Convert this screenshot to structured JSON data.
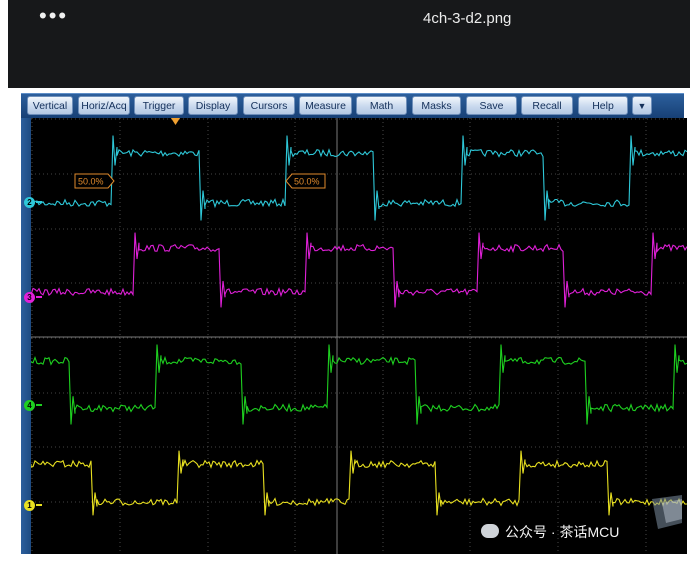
{
  "window": {
    "menu_dots": "•••",
    "filename": "4ch-3-d2.png"
  },
  "menu": {
    "items": [
      "Vertical",
      "Horiz/Acq",
      "Trigger",
      "Display",
      "Cursors",
      "Measure",
      "Math",
      "Masks",
      "Save",
      "Recall",
      "Help"
    ],
    "dropdown_glyph": "▼"
  },
  "scope": {
    "background": "#000000",
    "grid_color": "#5a5a5a",
    "cursor_labels": [
      "50.0%",
      "50.0%"
    ],
    "cursor_label_color": "#e08a2c",
    "trigger_marker_color": "#f0a030",
    "channels": [
      {
        "id": "2",
        "color": "#2ec8d8"
      },
      {
        "id": "3",
        "color": "#e020d8"
      },
      {
        "id": "4",
        "color": "#1ed020"
      },
      {
        "id": "1",
        "color": "#e8e020"
      }
    ]
  },
  "watermark": {
    "text": "公众号 · 茶话MCU"
  }
}
